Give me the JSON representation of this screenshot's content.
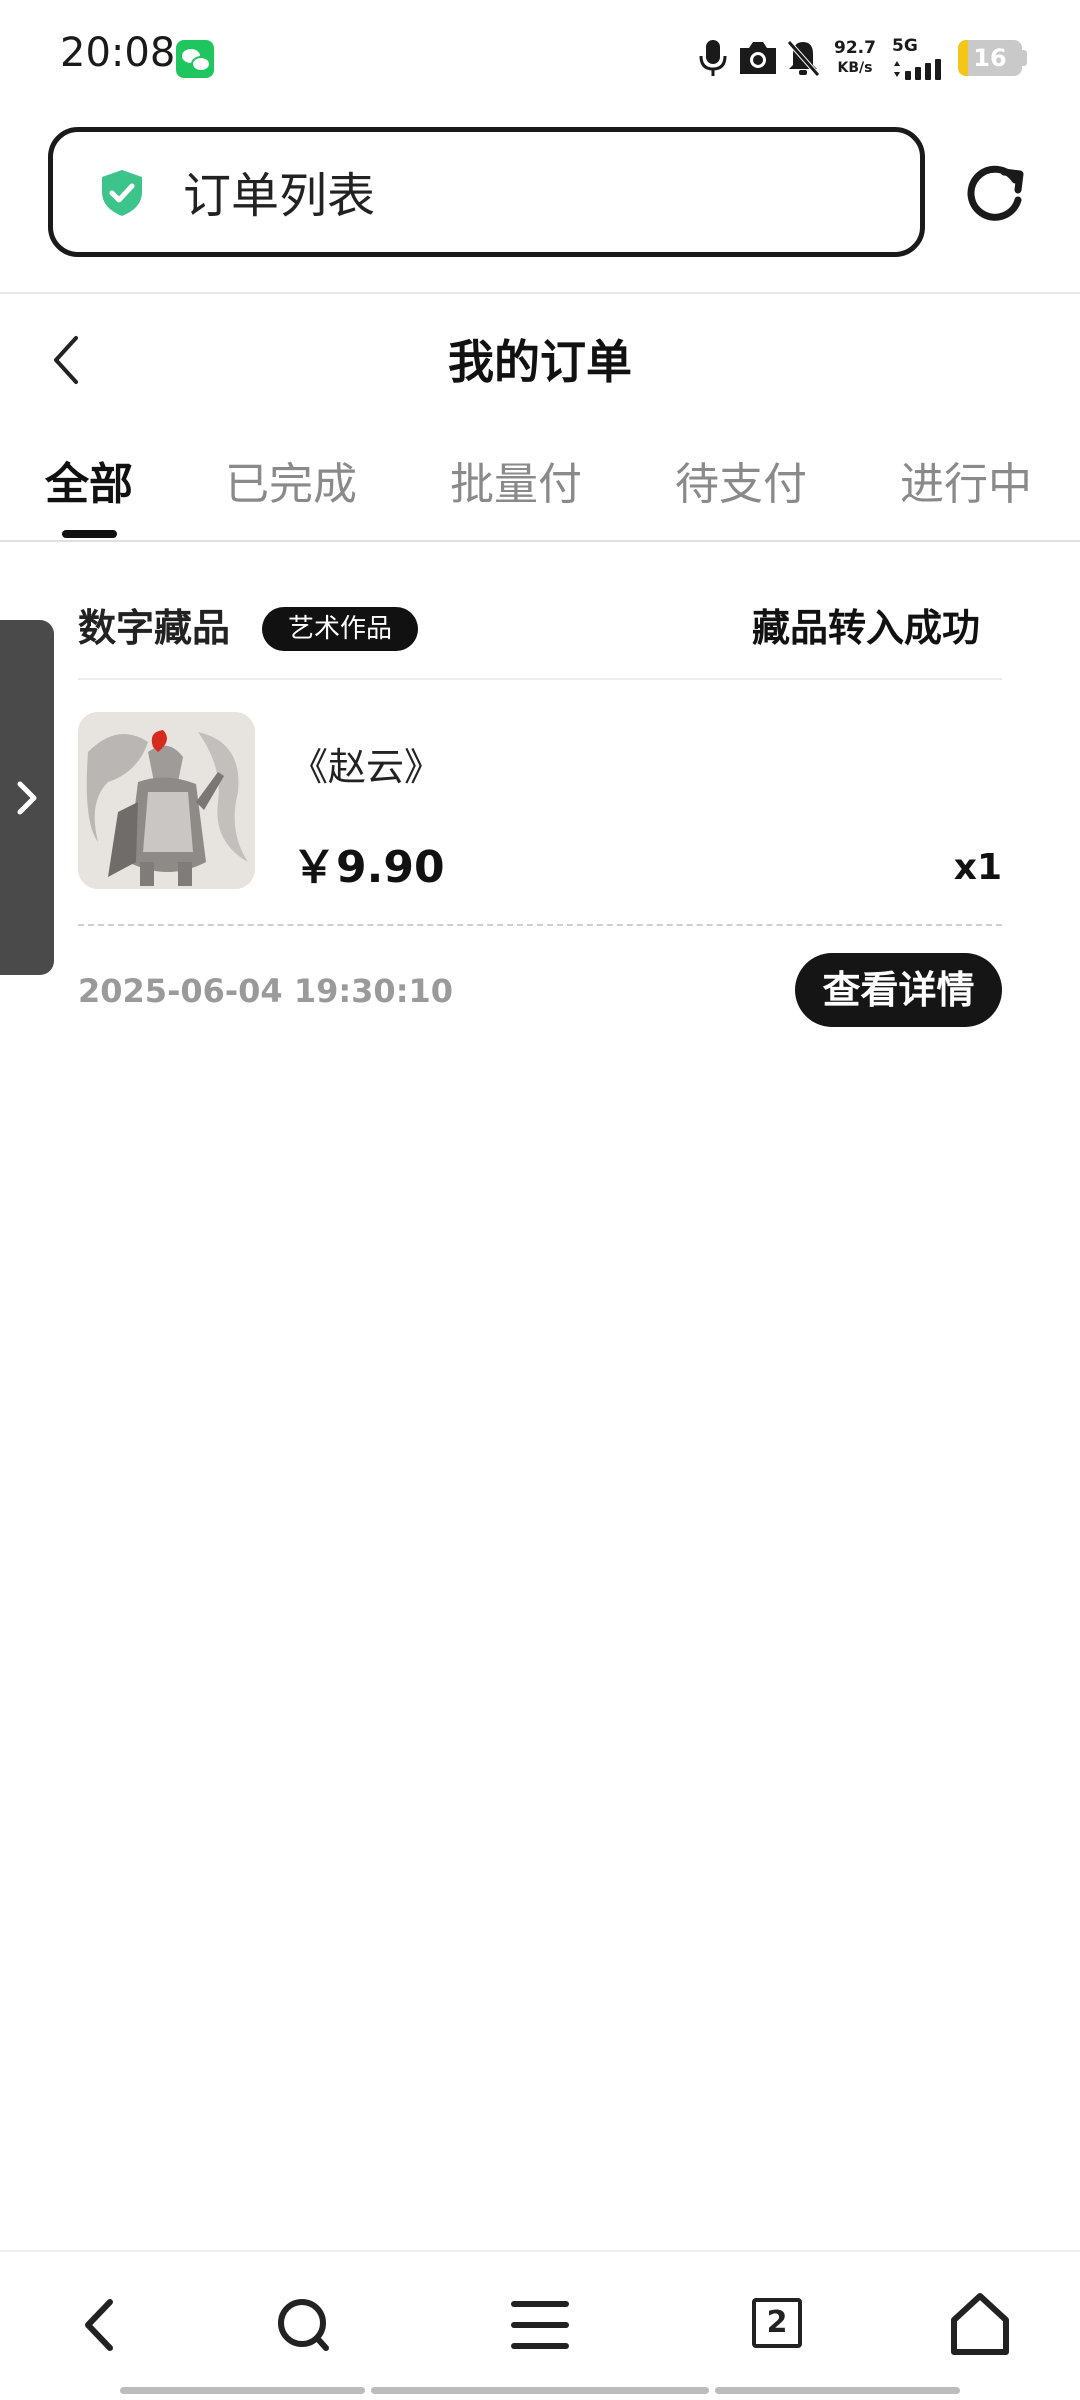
{
  "status_bar": {
    "time": "20:08",
    "network_speed": "92.7",
    "network_speed_unit": "KB/s",
    "network_type": "5G",
    "battery_level": "16",
    "battery_fraction": 0.16,
    "icons": [
      "wechat-icon",
      "mic-icon",
      "camera-icon",
      "bell-off-icon",
      "signal-icon",
      "battery-icon"
    ]
  },
  "browser": {
    "address_text": "订单列表",
    "secure_icon": "shield-check-icon",
    "reload_icon": "reload-icon"
  },
  "page": {
    "title": "我的订单",
    "back_icon": "chevron-left-icon"
  },
  "tabs": [
    {
      "label": "全部",
      "active": true
    },
    {
      "label": "已完成",
      "active": false
    },
    {
      "label": "批量付",
      "active": false
    },
    {
      "label": "待支付",
      "active": false
    },
    {
      "label": "进行中",
      "active": false
    }
  ],
  "orders": [
    {
      "category": "数字藏品",
      "tag": "艺术作品",
      "status": "藏品转入成功",
      "product_name": "《赵云》",
      "price": "￥9.90",
      "quantity": "x1",
      "time": "2025-06-04 19:30:10",
      "detail_button": "查看详情"
    }
  ],
  "bottom_nav": {
    "icons": [
      "back-icon",
      "search-icon",
      "menu-icon",
      "tabs-icon",
      "home-icon"
    ],
    "tab_count": "2"
  },
  "colors": {
    "accent_dark": "#111111",
    "secure_green": "#3cc48a",
    "muted_text": "#9a9a9a",
    "battery_fill": "#f5c518"
  }
}
